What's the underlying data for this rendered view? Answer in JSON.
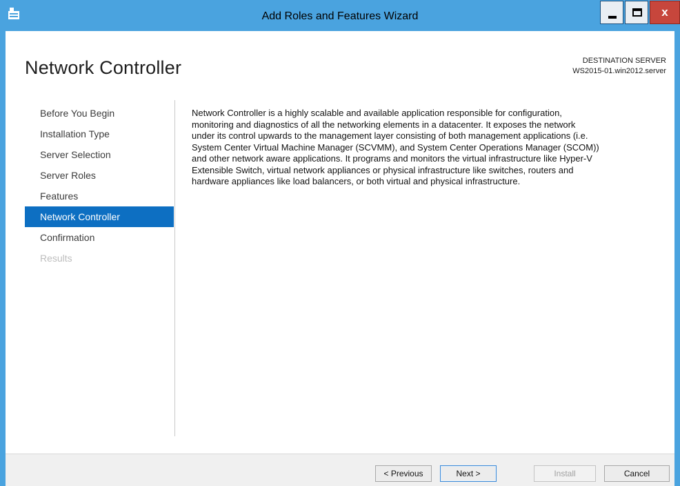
{
  "window": {
    "title": "Add Roles and Features Wizard",
    "controls": {
      "minimize": "minimize",
      "maximize": "maximize",
      "close": "x"
    }
  },
  "page": {
    "title": "Network Controller",
    "destination": {
      "label": "DESTINATION SERVER",
      "server": "WS2015-01.win2012.server"
    }
  },
  "nav": {
    "items": [
      {
        "label": "Before You Begin",
        "state": "normal"
      },
      {
        "label": "Installation Type",
        "state": "normal"
      },
      {
        "label": "Server Selection",
        "state": "normal"
      },
      {
        "label": "Server Roles",
        "state": "normal"
      },
      {
        "label": "Features",
        "state": "normal"
      },
      {
        "label": "Network Controller",
        "state": "active"
      },
      {
        "label": "Confirmation",
        "state": "normal"
      },
      {
        "label": "Results",
        "state": "disabled"
      }
    ]
  },
  "main": {
    "description_lines": [
      "Network Controller is a highly scalable and available application responsible for configuration,",
      "monitoring and diagnostics of all the networking elements in a datacenter. It exposes the network",
      "under its control upwards to the management layer consisting of both management applications (i.e.",
      "System Center Virtual Machine Manager (SCVMM), and System Center Operations Manager (SCOM))",
      "and other network aware applications. It programs and monitors the virtual infrastructure like Hyper-V",
      "Extensible Switch, virtual network appliances or physical infrastructure like switches, routers and",
      "hardware appliances like load balancers, or both virtual and physical infrastructure."
    ]
  },
  "footer": {
    "previous_label": "< Previous",
    "next_label": "Next >",
    "install_label": "Install",
    "cancel_label": "Cancel"
  },
  "colors": {
    "frame": "#4aa3df",
    "active_nav": "#0d6fc2",
    "close_button": "#c7463c"
  }
}
